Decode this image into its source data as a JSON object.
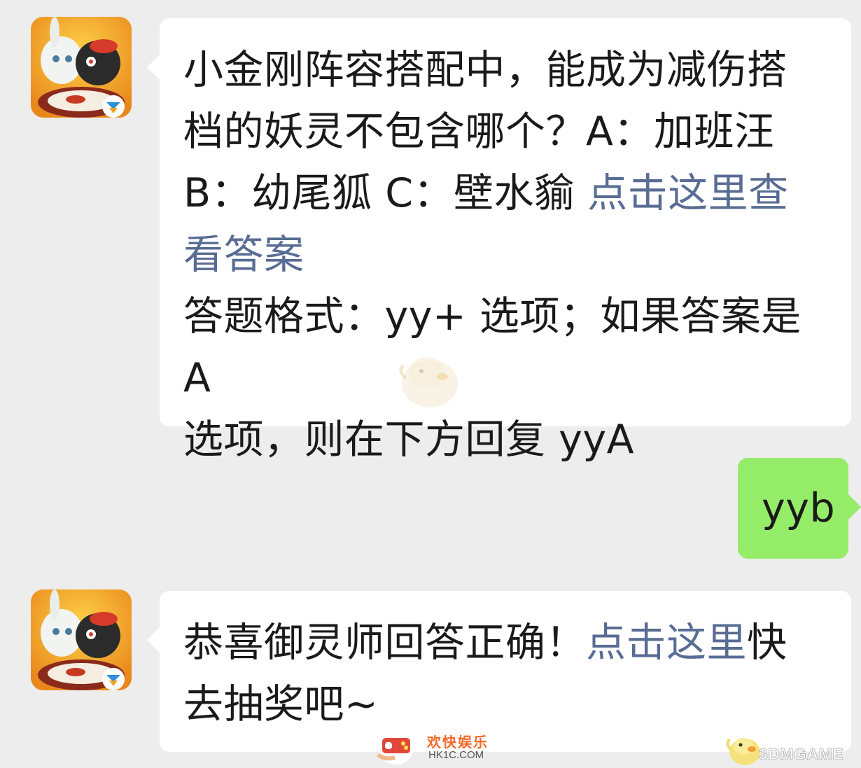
{
  "messages": [
    {
      "sender": "bot",
      "question": {
        "line1": "小金刚阵容搭配中，能成为减伤搭",
        "line2": "档的妖灵不包含哪个？A：加班汪",
        "line3_text": "B：幼尾狐 C：壁水貐 ",
        "line3_link": "点击这里查",
        "line4_link": "看答案"
      },
      "format_hint": {
        "line1": "答题格式：yy+ 选项；如果答案是 A",
        "line2": "选项，则在下方回复 yyA"
      }
    },
    {
      "sender": "user",
      "text": "yyb"
    },
    {
      "sender": "bot",
      "line1_text": "恭喜御灵师回答正确！",
      "line1_link": "点击这里",
      "line1_tail": "快",
      "line2_text": "去抽奖吧~"
    }
  ],
  "watermarks": {
    "hk1c_cn": "欢快娱乐",
    "hk1c_url": "HK1C.COM",
    "threedm": "3DMGAME"
  },
  "colors": {
    "background": "#ededed",
    "bubble_bot": "#ffffff",
    "bubble_user": "#95ec69",
    "link": "#586c94",
    "avatar_bg": "#f3a020"
  },
  "icons": {
    "avatar": "game-app-avatar-icon",
    "hk1c_logo": "controller-hand-icon",
    "threedm_logo": "chick-mascot-icon"
  }
}
